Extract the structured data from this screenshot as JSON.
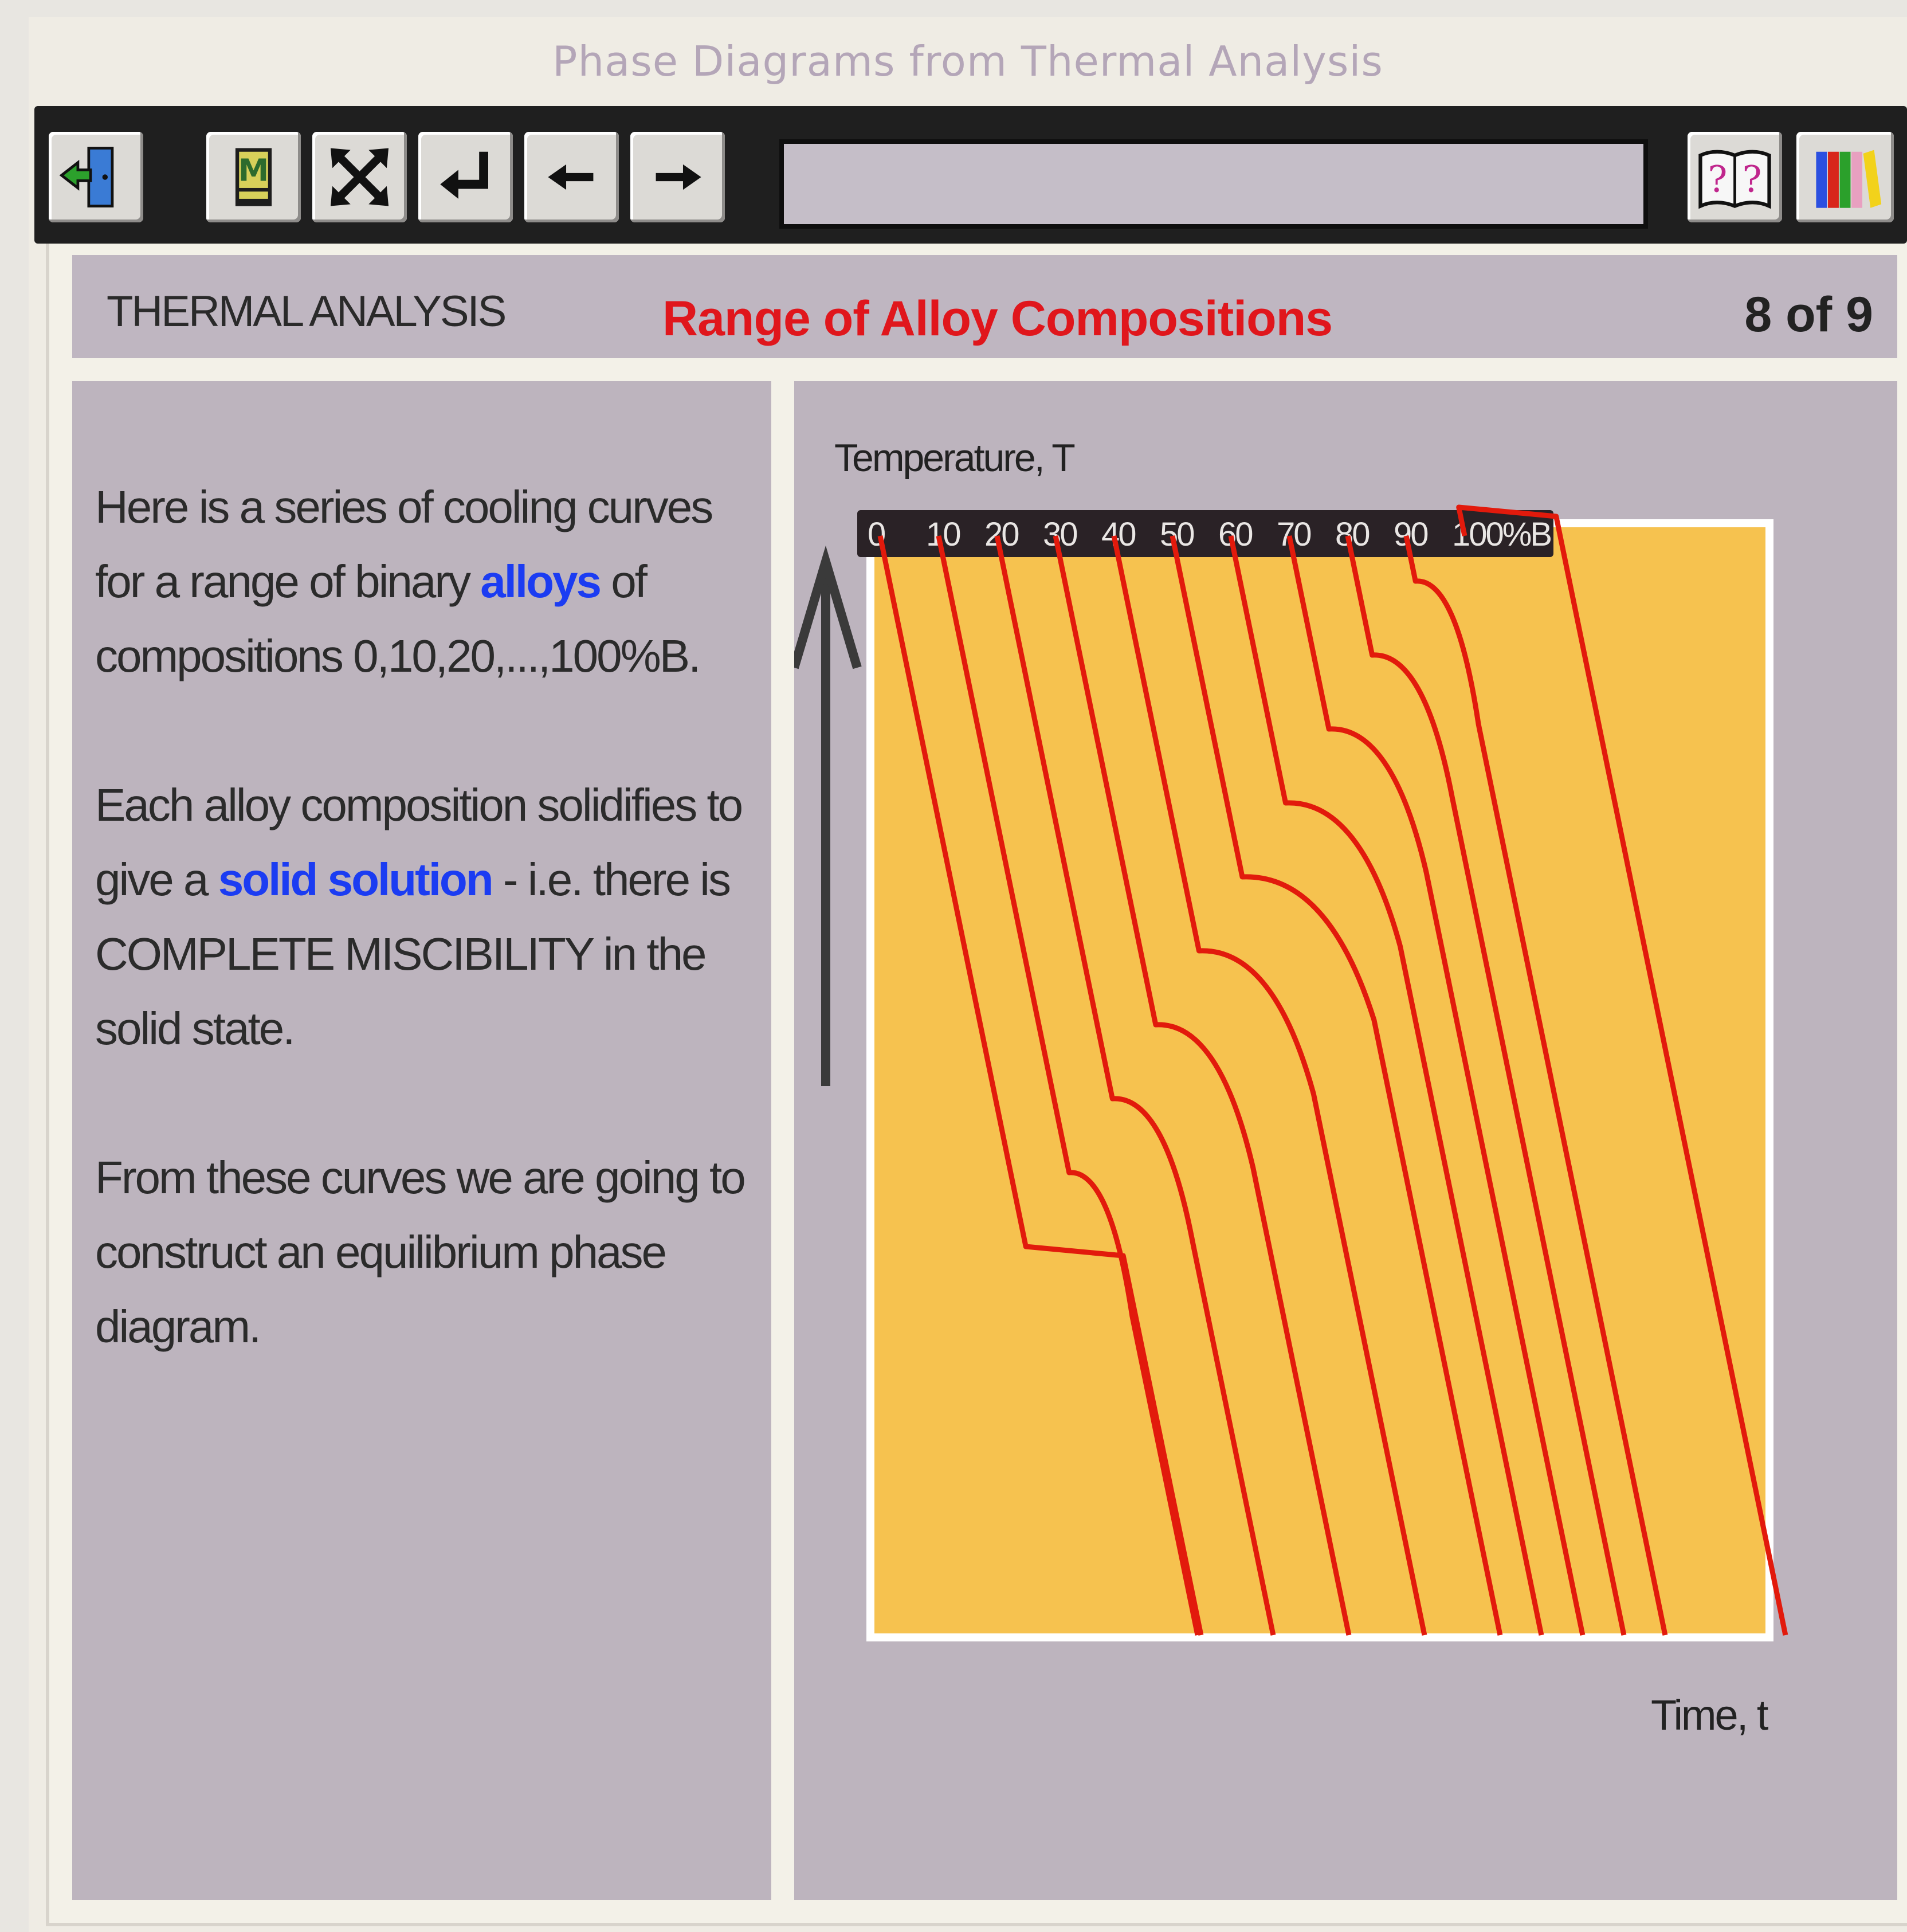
{
  "window": {
    "title": "Phase Diagrams from Thermal Analysis"
  },
  "toolbar": {
    "buttons": [
      {
        "name": "exit",
        "icon": "exit-door-icon"
      },
      {
        "name": "menu",
        "icon": "menu-m-icon"
      },
      {
        "name": "expand",
        "icon": "expand-arrows-icon"
      },
      {
        "name": "return",
        "icon": "return-arrow-icon"
      },
      {
        "name": "back",
        "icon": "arrow-left-icon"
      },
      {
        "name": "forward",
        "icon": "arrow-right-icon"
      },
      {
        "name": "help",
        "icon": "help-book-icon"
      },
      {
        "name": "library",
        "icon": "library-books-icon"
      }
    ],
    "address_value": ""
  },
  "header": {
    "section": "THERMAL ANALYSIS",
    "title": "Range of Alloy Compositions",
    "page": "8 of 9"
  },
  "text_panel": {
    "p1_a": "Here is a series of cooling curves for a range of binary ",
    "p1_link": "alloys",
    "p1_b": " of compositions 0,10,20,...,100%B.",
    "p2_a": "Each alloy composition solidifies to give a ",
    "p2_link": "solid solution",
    "p2_b": " - i.e. there is COMPLETE MISCIBILITY in the solid state.",
    "p3": "From these curves we are going to construct an equilibrium phase diagram."
  },
  "chart_data": {
    "type": "line",
    "xlabel": "Time, t",
    "ylabel": "Temperature, T",
    "composition_labels": [
      "0",
      "10",
      "20",
      "30",
      "40",
      "50",
      "60",
      "70",
      "80",
      "90",
      "100%B"
    ],
    "composition_unit": "%B",
    "compositions": [
      0,
      10,
      20,
      30,
      40,
      50,
      60,
      70,
      80,
      90,
      100
    ],
    "colors": {
      "curve": "#e21a0c",
      "plot_background": "#f6c24f",
      "plot_border": "#ffffff",
      "label_bar": "#2a2226",
      "axis_arrow": "#3a3a3a"
    }
  }
}
